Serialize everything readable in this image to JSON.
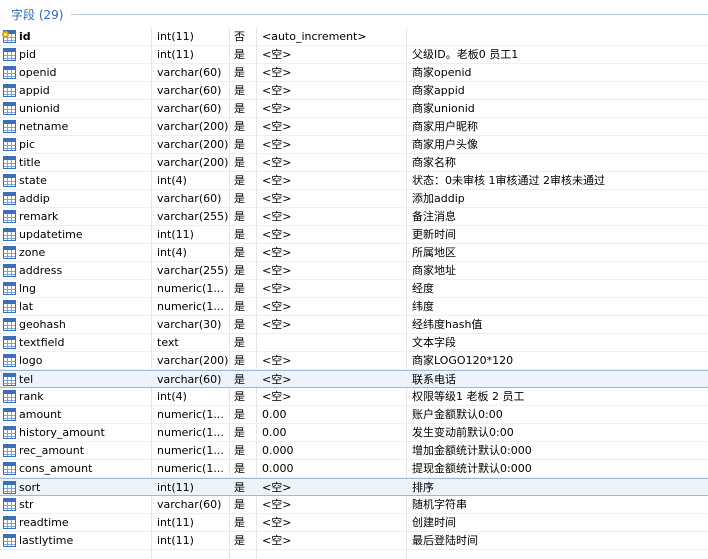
{
  "section": {
    "title": "字段 (29)"
  },
  "fields": [
    {
      "name": "id",
      "type": "int(11)",
      "nullable": "否",
      "default": "<auto_increment>",
      "comment": "",
      "primary": true
    },
    {
      "name": "pid",
      "type": "int(11)",
      "nullable": "是",
      "default": "<空>",
      "comment": "父级ID。老板0 员工1"
    },
    {
      "name": "openid",
      "type": "varchar(60)",
      "nullable": "是",
      "default": "<空>",
      "comment": "商家openid"
    },
    {
      "name": "appid",
      "type": "varchar(60)",
      "nullable": "是",
      "default": "<空>",
      "comment": "商家appid"
    },
    {
      "name": "unionid",
      "type": "varchar(60)",
      "nullable": "是",
      "default": "<空>",
      "comment": "商家unionid"
    },
    {
      "name": "netname",
      "type": "varchar(200)",
      "nullable": "是",
      "default": "<空>",
      "comment": "商家用户昵称"
    },
    {
      "name": "pic",
      "type": "varchar(200)",
      "nullable": "是",
      "default": "<空>",
      "comment": "商家用户头像"
    },
    {
      "name": "title",
      "type": "varchar(200)",
      "nullable": "是",
      "default": "<空>",
      "comment": "商家名称"
    },
    {
      "name": "state",
      "type": "int(4)",
      "nullable": "是",
      "default": "<空>",
      "comment": "状态：0未审核 1审核通过 2审核未通过"
    },
    {
      "name": "addip",
      "type": "varchar(60)",
      "nullable": "是",
      "default": "<空>",
      "comment": "添加addip"
    },
    {
      "name": "remark",
      "type": "varchar(255)",
      "nullable": "是",
      "default": "<空>",
      "comment": "备注消息"
    },
    {
      "name": "updatetime",
      "type": "int(11)",
      "nullable": "是",
      "default": "<空>",
      "comment": "更新时间"
    },
    {
      "name": "zone",
      "type": "int(4)",
      "nullable": "是",
      "default": "<空>",
      "comment": "所属地区"
    },
    {
      "name": "address",
      "type": "varchar(255)",
      "nullable": "是",
      "default": "<空>",
      "comment": "商家地址"
    },
    {
      "name": "lng",
      "type": "numeric(1...",
      "nullable": "是",
      "default": "<空>",
      "comment": "经度"
    },
    {
      "name": "lat",
      "type": "numeric(1...",
      "nullable": "是",
      "default": "<空>",
      "comment": "纬度"
    },
    {
      "name": "geohash",
      "type": "varchar(30)",
      "nullable": "是",
      "default": "<空>",
      "comment": "经纬度hash值"
    },
    {
      "name": "textfield",
      "type": "text",
      "nullable": "是",
      "default": "",
      "comment": "文本字段"
    },
    {
      "name": "logo",
      "type": "varchar(200)",
      "nullable": "是",
      "default": "<空>",
      "comment": "商家LOGO120*120"
    },
    {
      "name": "tel",
      "type": "varchar(60)",
      "nullable": "是",
      "default": "<空>",
      "comment": "联系电话",
      "selected": true
    },
    {
      "name": "rank",
      "type": "int(4)",
      "nullable": "是",
      "default": "<空>",
      "comment": "权限等级1 老板 2 员工"
    },
    {
      "name": "amount",
      "type": "numeric(1...",
      "nullable": "是",
      "default": "0.00",
      "comment": "账户金额默认0:00"
    },
    {
      "name": "history_amount",
      "type": "numeric(1...",
      "nullable": "是",
      "default": "0.00",
      "comment": "发生变动前默认0:00"
    },
    {
      "name": "rec_amount",
      "type": "numeric(1...",
      "nullable": "是",
      "default": "0.000",
      "comment": "增加金额统计默认0:000"
    },
    {
      "name": "cons_amount",
      "type": "numeric(1...",
      "nullable": "是",
      "default": "0.000",
      "comment": "提现金额统计默认0:000"
    },
    {
      "name": "sort",
      "type": "int(11)",
      "nullable": "是",
      "default": "<空>",
      "comment": "排序",
      "selected": true
    },
    {
      "name": "str",
      "type": "varchar(60)",
      "nullable": "是",
      "default": "<空>",
      "comment": "随机字符串"
    },
    {
      "name": "readtime",
      "type": "int(11)",
      "nullable": "是",
      "default": "<空>",
      "comment": "创建时间"
    },
    {
      "name": "lastlytime",
      "type": "int(11)",
      "nullable": "是",
      "default": "<空>",
      "comment": "最后登陆时间"
    }
  ],
  "icons": {
    "field": "table-field-icon",
    "primary_key": "key-icon"
  },
  "colors": {
    "accent": "#2a6bbf",
    "icon": "#3b6fb6",
    "selection": "#edf3fb"
  }
}
